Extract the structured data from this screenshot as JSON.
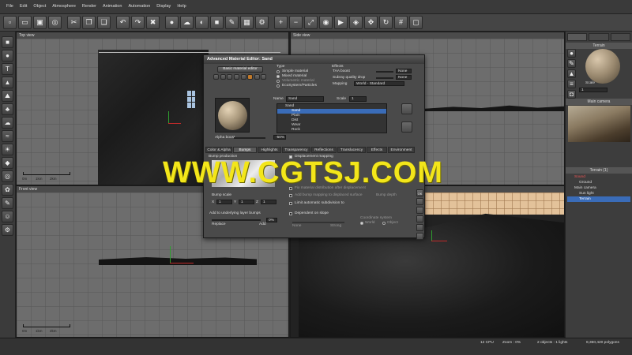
{
  "menu": [
    "File",
    "Edit",
    "Object",
    "Atmosphere",
    "Render",
    "Animation",
    "Automation",
    "Display",
    "Help"
  ],
  "toolbar_icons": [
    "new-icon",
    "open-icon",
    "save-icon",
    "render-icon",
    "cut-icon",
    "copy-icon",
    "paste-icon",
    "undo-icon",
    "redo-icon",
    "delete-icon",
    "material-icon",
    "atmosphere-icon",
    "sky-icon",
    "object-icon",
    "edit-icon",
    "image-icon",
    "settings-icon",
    "zoom-in-icon",
    "zoom-out-icon",
    "zoom-fit-icon",
    "preview-icon",
    "play-icon",
    "camera-icon",
    "pan-icon",
    "rotate-icon",
    "grid-icon",
    "view-icon"
  ],
  "left_tools": [
    "cube-icon",
    "sphere-icon",
    "text-icon",
    "terrain-icon",
    "mountain-icon",
    "plant-icon",
    "cloud-icon",
    "water-icon",
    "light-icon",
    "rock-icon",
    "lens-icon",
    "eco-icon",
    "paint-icon",
    "figure-icon",
    "gear-icon"
  ],
  "viewports": {
    "top": {
      "title": "Top view"
    },
    "side": {
      "title": "Side view"
    },
    "front": {
      "title": "Front view"
    },
    "main": {
      "title": "Main camera"
    }
  },
  "scale_labels": [
    "0m",
    "1km",
    "2km"
  ],
  "right_panel": {
    "terrain_header": "Terrain",
    "scale_label": "Scale",
    "scale_value": "1",
    "main_camera_header": "Main camera",
    "layers_header": "Terrain (1)",
    "tree": [
      {
        "label": "Sound",
        "indent": 1,
        "selected": false,
        "red": true
      },
      {
        "label": "Ground",
        "indent": 2,
        "selected": false,
        "red": false
      },
      {
        "label": "Main camera",
        "indent": 1,
        "selected": false,
        "red": false
      },
      {
        "label": "Sun light",
        "indent": 2,
        "selected": false,
        "red": false
      },
      {
        "label": "Terrain",
        "indent": 2,
        "selected": true,
        "red": false
      }
    ]
  },
  "status": {
    "cpu": "12 CPU",
    "zoom": "Zoom : 0%",
    "objects": "2 objects : 1 lights",
    "polygons": "8,360,420 polygons"
  },
  "dialog": {
    "title": "Advanced Material Editor: Sand",
    "basic_button": "Basic material editor",
    "type_label": "Type",
    "type_options": [
      {
        "label": "Simple material",
        "on": false
      },
      {
        "label": "Mixed material",
        "on": true
      },
      {
        "label": "Volumetric material",
        "on": false
      },
      {
        "label": "EcoSystem/Particles",
        "on": false
      }
    ],
    "effects_label": "Effects",
    "taa_label": "TAA boost",
    "taa_value": "None",
    "subray_label": "Subray quality drop",
    "subray_value": "None",
    "mapping_label": "Mapping",
    "mapping_value": "World - Standard",
    "name_label": "Name",
    "name_value": "Sand",
    "scale_label": "Scale",
    "scale_value": "1",
    "alpha_label": "Alpha boost",
    "alpha_value": "-50%",
    "layers": [
      {
        "label": "Sand",
        "selected": false,
        "indent": 0
      },
      {
        "label": "Sand",
        "selected": true,
        "indent": 1
      },
      {
        "label": "Plain",
        "indent": 1,
        "selected": false
      },
      {
        "label": "Dist",
        "indent": 1,
        "selected": false
      },
      {
        "label": "Wear",
        "indent": 1,
        "selected": false
      },
      {
        "label": "Rock",
        "indent": 1,
        "selected": false
      }
    ],
    "tabs": [
      "Color & Alpha",
      "Bumps",
      "Highlights",
      "Transparency",
      "Reflections",
      "Translucency",
      "Effects",
      "Environment"
    ],
    "active_tab": "Bumps",
    "bump_production": "Bump production",
    "displacement": "Displacement mapping",
    "bump_scale": "Bump scale",
    "xyz": [
      "X",
      "Y",
      "Z"
    ],
    "xyz_values": [
      "1",
      "1",
      "1"
    ],
    "fix_material": "Fix material distribution after displacement",
    "add_bump": "Add bump mapping to displaced surface",
    "bump_depth": "Bump depth",
    "limit_subdiv": "Limit automatic subdivision to",
    "add_underlying": "Add to underlying layer bumps",
    "replace": "Replace",
    "add": "Add",
    "add_value": "0%",
    "dependent_slope": "Dependent on slope",
    "coordinate_system": "Coordinate system",
    "none": "None",
    "strong": "Strong",
    "world": "World",
    "object": "Object",
    "ok": "OK"
  },
  "watermark": "WWW.CGTSJ.COM"
}
